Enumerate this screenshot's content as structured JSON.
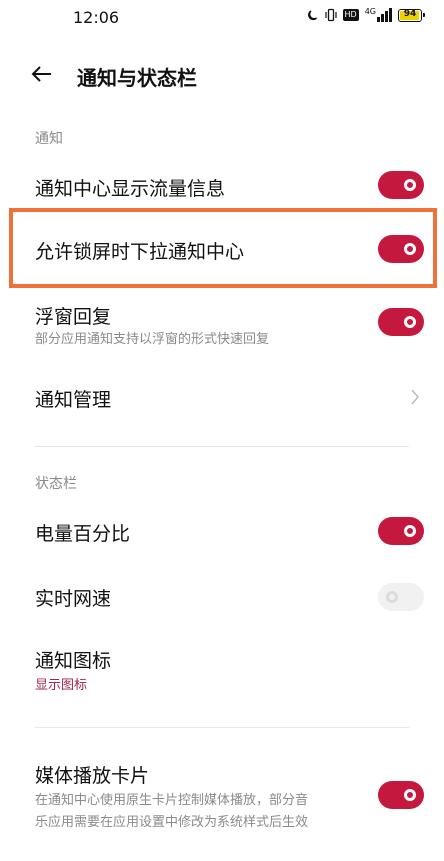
{
  "status_bar": {
    "time": "12:06",
    "icons": [
      "moon-icon",
      "vibrate-icon",
      "hd-icon",
      "4g-signal-icon",
      "battery-icon"
    ],
    "hd_label": "HD",
    "network_label": "4G",
    "battery_level": "94"
  },
  "header": {
    "title": "通知与状态栏",
    "back_icon": "back-arrow-icon"
  },
  "sections": {
    "notification": "通知",
    "status_bar": "状态栏"
  },
  "items": {
    "traffic_info": {
      "title": "通知中心显示流量信息",
      "enabled": true
    },
    "lockscreen_pulldown": {
      "title": "允许锁屏时下拉通知中心",
      "enabled": true
    },
    "floating_reply": {
      "title": "浮窗回复",
      "subtitle": "部分应用通知支持以浮窗的形式快速回复",
      "enabled": true
    },
    "notification_manage": {
      "title": "通知管理"
    },
    "battery_percent": {
      "title": "电量百分比",
      "enabled": true
    },
    "realtime_speed": {
      "title": "实时网速",
      "enabled": false
    },
    "notification_icons": {
      "title": "通知图标",
      "subtitle": "显示图标"
    },
    "media_card": {
      "title": "媒体播放卡片",
      "subtitle_line1": "在通知中心使用原生卡片控制媒体播放，部分音",
      "subtitle_line2": "乐应用需要在应用设置中修改为系统样式后生效",
      "enabled": true
    }
  },
  "colors": {
    "accent": "#c5183f",
    "highlight_border": "#f0703a",
    "toggle_off": "#f1f1f1"
  }
}
